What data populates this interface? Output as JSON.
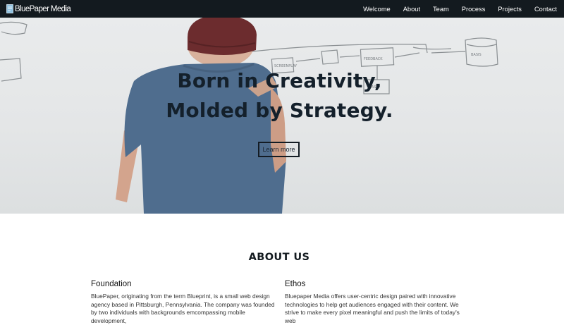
{
  "navbar": {
    "brand": "BluePaper Media",
    "brand_logo_icon": "paper-document-icon",
    "links": [
      "Welcome",
      "About",
      "Team",
      "Process",
      "Projects",
      "Contact"
    ]
  },
  "hero": {
    "title_line1": "Born in Creativity,",
    "title_line2": "Molded by Strategy.",
    "cta_label": "Learn more",
    "whiteboard_labels": [
      "SCREENPLAY",
      "FEEDBACK",
      "TASK",
      "BASIS"
    ]
  },
  "about": {
    "heading": "ABOUT US",
    "columns": [
      {
        "heading": "Foundation",
        "body": "BluePaper, originating from the term Blueprint, is a small web design agency based in Pittsburgh, Pennsylvania. The company was founded by two individuals with backgrounds emcompassing mobile development,"
      },
      {
        "heading": "Ethos",
        "body": "Bluepaper Media offers user-centric design paired with innovative technologies to help get audiences engaged with their content. We strive to make every pixel meaningful and push the limits of today's web"
      }
    ]
  },
  "colors": {
    "navbar_bg": "#131a1f",
    "hero_text": "#14202b",
    "page_bg": "#ffffff"
  }
}
